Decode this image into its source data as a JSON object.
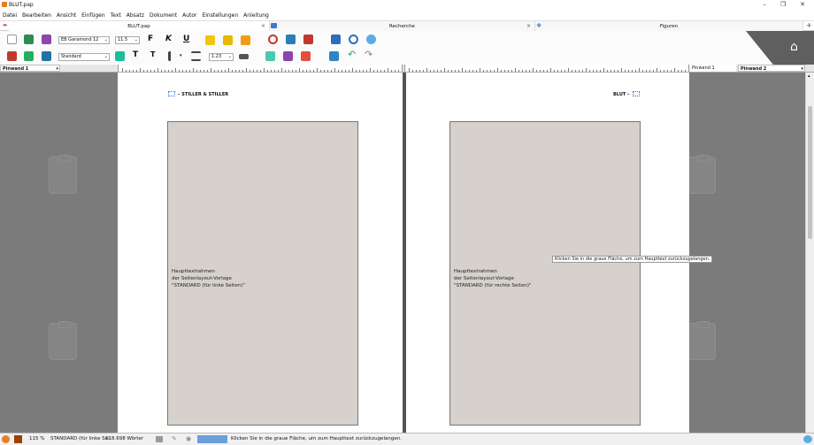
{
  "window": {
    "title": "BLUT.pap",
    "min": "–",
    "restore": "❐",
    "close": "✕"
  },
  "menu": [
    "Datei",
    "Bearbeiten",
    "Ansicht",
    "Einfügen",
    "Text",
    "Absatz",
    "Dokument",
    "Autor",
    "Einstellungen",
    "Anleitung"
  ],
  "tabs": [
    {
      "label": "BLUT.pap"
    },
    {
      "label": "Recherche"
    },
    {
      "label": "Figuren"
    }
  ],
  "tab_close": "×",
  "tab_add": "+",
  "toolbar": {
    "font_name": "EB Garamond 12",
    "font_size": "11.5",
    "style": "Standard",
    "line_spacing": "1.23",
    "bold": "F",
    "italic": "K",
    "underline": "U",
    "superscript": "T",
    "subscript": "T"
  },
  "pinwand": {
    "left": "Pinwand 1",
    "right_inner": "Pinwand 1",
    "right": "Pinwand 2"
  },
  "pages": {
    "left_header": "– STILLER & STILLER",
    "right_header": "BLUT –",
    "left_frame": [
      "Haupttextrahmen",
      "der Seitenlayout-Vorlage",
      "\"STANDARD (für linke Seiten)\""
    ],
    "right_frame": [
      "Haupttextrahmen",
      "der Seitenlayout-Vorlage",
      "\"STANDARD (für rechte Seiten)\""
    ]
  },
  "tooltip": "Klicken Sie in die graue Fläche, um zum Haupttext zurückzugelangen.",
  "status": {
    "zoom": "115 %",
    "layout": "STANDARD (für linke Sei",
    "words": "118.698 Wörter",
    "message": "Klicken Sie in die graue Fläche, um zum Haupttext zurückzugelangen."
  },
  "colors": {
    "workspace": "#7b7b7b",
    "frame": "#d6d1cc",
    "accent": "#3a7bd5"
  }
}
